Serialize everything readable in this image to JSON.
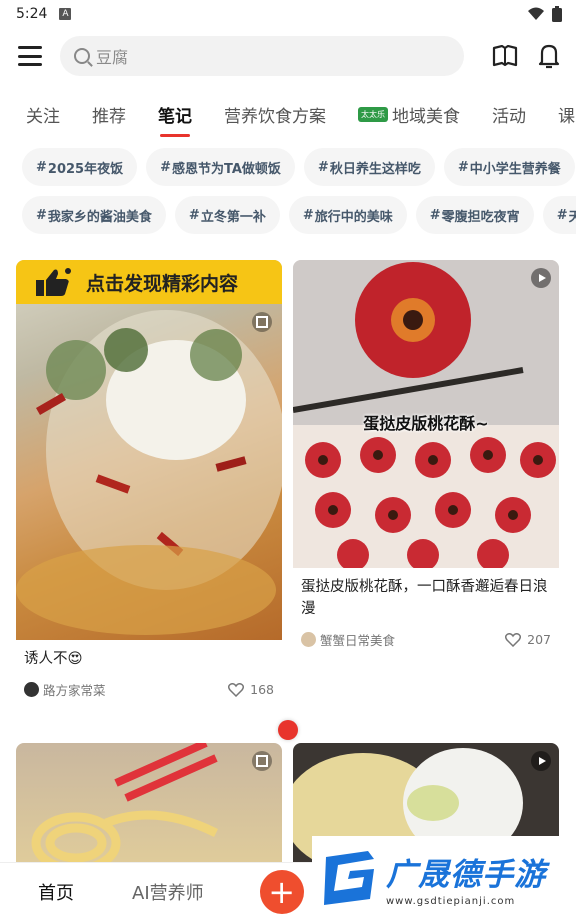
{
  "status": {
    "time": "5:24",
    "notif_icon": "A"
  },
  "search": {
    "placeholder": "豆腐"
  },
  "tabs": [
    {
      "label": "关注"
    },
    {
      "label": "推荐"
    },
    {
      "label": "笔记",
      "active": true
    },
    {
      "label": "营养饮食方案"
    },
    {
      "label": "地域美食",
      "badge": "太太乐"
    },
    {
      "label": "活动"
    },
    {
      "label": "课"
    }
  ],
  "chips_row1": [
    "2025年夜饭",
    "感恩节为TA做顿饭",
    "秋日养生这样吃",
    "中小学生营养餐"
  ],
  "chips_row2": [
    "我家乡的酱油美食",
    "立冬第一补",
    "旅行中的美味",
    "零腹担吃夜宵",
    "天"
  ],
  "cards": [
    {
      "banner": "点击发现精彩内容",
      "title": "诱人不😍",
      "author": "路方家常菜",
      "likes": "168"
    },
    {
      "overlay": "蛋挞皮版桃花酥~",
      "title": "蛋挞皮版桃花酥，一口酥香邂逅春日浪漫",
      "author": "蟹蟹日常美食",
      "likes": "207"
    }
  ],
  "bottom_nav": {
    "home": "首页",
    "ai": "AI营养师",
    "add": "+"
  },
  "watermark": {
    "name": "广晟德手游",
    "url": "www.gsdtiepianji.com"
  },
  "colors": {
    "accent": "#e8342c",
    "banner": "#f6c515",
    "chip_text": "#46586b",
    "brand_blue": "#1a73d9"
  }
}
